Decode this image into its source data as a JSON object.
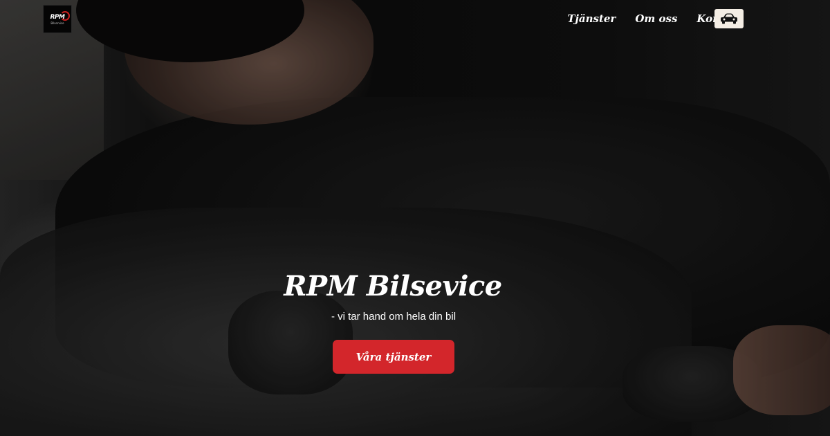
{
  "header": {
    "logo": {
      "text": "RPM",
      "subtext": "Bilservice",
      "icon": "rpm-logo"
    },
    "nav": [
      {
        "label": "Tjänster"
      },
      {
        "label": "Om oss"
      },
      {
        "label": "Kontakt"
      }
    ],
    "car_button": {
      "icon": "car-icon",
      "bg_color": "#f4ede4"
    }
  },
  "hero": {
    "title": "RPM Bilsevice",
    "subtitle": "- vi tar hand om hela din bil",
    "cta_label": "Våra tjänster",
    "cta_color": "#d3262b"
  }
}
